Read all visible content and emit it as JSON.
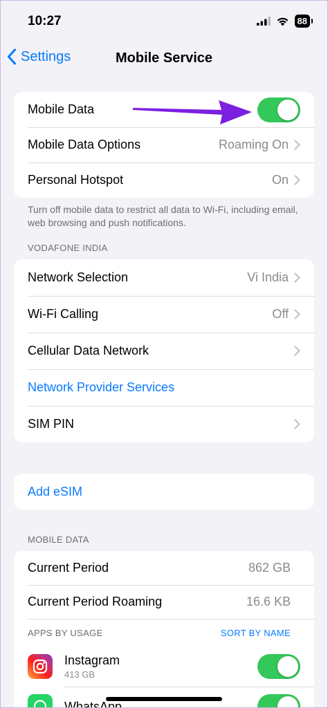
{
  "status_bar": {
    "time": "10:27",
    "battery": "88"
  },
  "nav": {
    "back_label": "Settings",
    "title": "Mobile Service"
  },
  "main_group": {
    "mobile_data_label": "Mobile Data",
    "mobile_data_on": true,
    "data_options_label": "Mobile Data Options",
    "data_options_value": "Roaming On",
    "hotspot_label": "Personal Hotspot",
    "hotspot_value": "On"
  },
  "main_footnote": "Turn off mobile data to restrict all data to Wi-Fi, including email, web browsing and push notifications.",
  "carrier_section": {
    "header": "VODAFONE INDIA",
    "network_selection_label": "Network Selection",
    "network_selection_value": "Vi India",
    "wifi_calling_label": "Wi-Fi Calling",
    "wifi_calling_value": "Off",
    "cellular_network_label": "Cellular Data Network",
    "provider_services_label": "Network Provider Services",
    "sim_pin_label": "SIM PIN"
  },
  "esim": {
    "label": "Add eSIM"
  },
  "usage_section": {
    "header": "MOBILE DATA",
    "current_period_label": "Current Period",
    "current_period_value": "862 GB",
    "roaming_label": "Current Period Roaming",
    "roaming_value": "16.6 KB",
    "apps_header": "APPS BY USAGE",
    "sort_label": "SORT BY NAME",
    "apps": [
      {
        "name": "Instagram",
        "usage": "413 GB",
        "icon": "instagram-icon",
        "enabled": true
      },
      {
        "name": "WhatsApp",
        "usage": "",
        "icon": "whatsapp-icon",
        "enabled": true
      }
    ]
  },
  "colors": {
    "accent": "#0a7aff",
    "toggle_on": "#34c759",
    "arrow": "#7b1fe0",
    "background": "#f2f2f7"
  }
}
